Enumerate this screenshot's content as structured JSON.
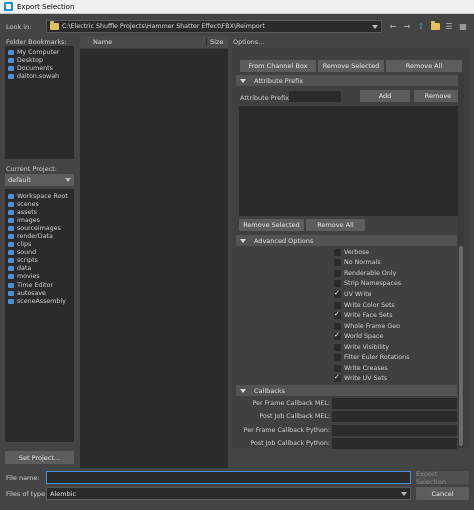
{
  "window": {
    "title": "Export Selection"
  },
  "look_in": {
    "label": "Look in:",
    "path": "C:\\Electric Shuffle Projects\\Hammer Shatter Effect\\FBX\\Reimport"
  },
  "toolbar_icons": [
    "back-icon",
    "forward-icon",
    "up-folder-icon",
    "new-folder-icon",
    "list-view-icon",
    "detail-view-icon"
  ],
  "bookmarks": {
    "label": "Folder Bookmarks:",
    "items": [
      "My Computer",
      "Desktop",
      "Documents",
      "dalton.sowah"
    ]
  },
  "project": {
    "label": "Current Project:",
    "selected": "default",
    "folders": [
      "Workspace Root",
      "scenes",
      "assets",
      "images",
      "sourceimages",
      "renderData",
      "clips",
      "sound",
      "scripts",
      "data",
      "movies",
      "Time Editor",
      "autosave",
      "sceneAssembly"
    ],
    "set_project_label": "Set Project..."
  },
  "file_list": {
    "columns": [
      "Name",
      "Size"
    ]
  },
  "options": {
    "label": "Options...",
    "from_channel_box": "From Channel Box",
    "remove_selected": "Remove Selected",
    "remove_all": "Remove All",
    "attribute_prefix": {
      "header": "Attribute Prefix",
      "field_label": "Attribute Prefix:",
      "add": "Add",
      "remove": "Remove",
      "remove_selected": "Remove Selected",
      "remove_all": "Remove All"
    },
    "advanced": {
      "header": "Advanced Options",
      "checkboxes": [
        {
          "label": "Verbose",
          "checked": false
        },
        {
          "label": "No Normals",
          "checked": false
        },
        {
          "label": "Renderable Only",
          "checked": false
        },
        {
          "label": "Strip Namespaces",
          "checked": false
        },
        {
          "label": "UV Write",
          "checked": true
        },
        {
          "label": "Write Color Sets",
          "checked": false
        },
        {
          "label": "Write Face Sets",
          "checked": true
        },
        {
          "label": "Whole Frame Geo",
          "checked": false
        },
        {
          "label": "World Space",
          "checked": true
        },
        {
          "label": "Write Visibility",
          "checked": false
        },
        {
          "label": "Filter Euler Rotations",
          "checked": false
        },
        {
          "label": "Write Creases",
          "checked": false
        },
        {
          "label": "Write UV Sets",
          "checked": true
        }
      ]
    },
    "callbacks": {
      "header": "Callbacks",
      "rows": [
        "Per Frame Callback MEL:",
        "Post Job Callback MEL:",
        "Per Frame Callback Python:",
        "Post Job Callback Python:"
      ]
    }
  },
  "bottom": {
    "file_name_label": "File name:",
    "file_name_value": "",
    "files_of_type_label": "Files of type:",
    "files_of_type_value": "Alembic",
    "export_button": "Export Selection",
    "cancel_button": "Cancel"
  }
}
